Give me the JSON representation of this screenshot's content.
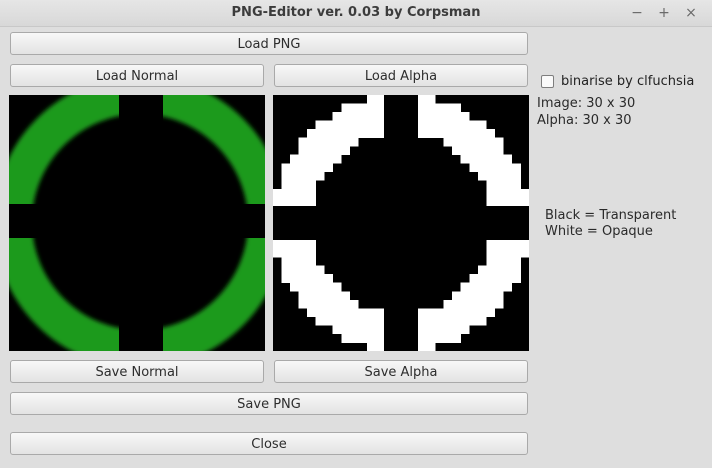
{
  "window": {
    "title": "PNG-Editor ver. 0.03 by Corpsman",
    "controls": {
      "minimize": "−",
      "maximize": "+",
      "close": "×"
    }
  },
  "buttons": {
    "load_png": "Load PNG",
    "load_normal": "Load Normal",
    "load_alpha": "Load Alpha",
    "save_normal": "Save Normal",
    "save_alpha": "Save Alpha",
    "save_png": "Save PNG",
    "close": "Close"
  },
  "options": {
    "binarise_label": "binarise by clfuchsia",
    "binarise_checked": false
  },
  "info": {
    "image_size": "Image: 30 x 30",
    "alpha_size": "Alpha: 30 x 30",
    "legend_black": "Black = Transparent",
    "legend_white": "White = Opaque"
  },
  "colors": {
    "normal_ring": "#1f9a1f",
    "alpha_ring": "#ffffff",
    "background": "#000000"
  }
}
